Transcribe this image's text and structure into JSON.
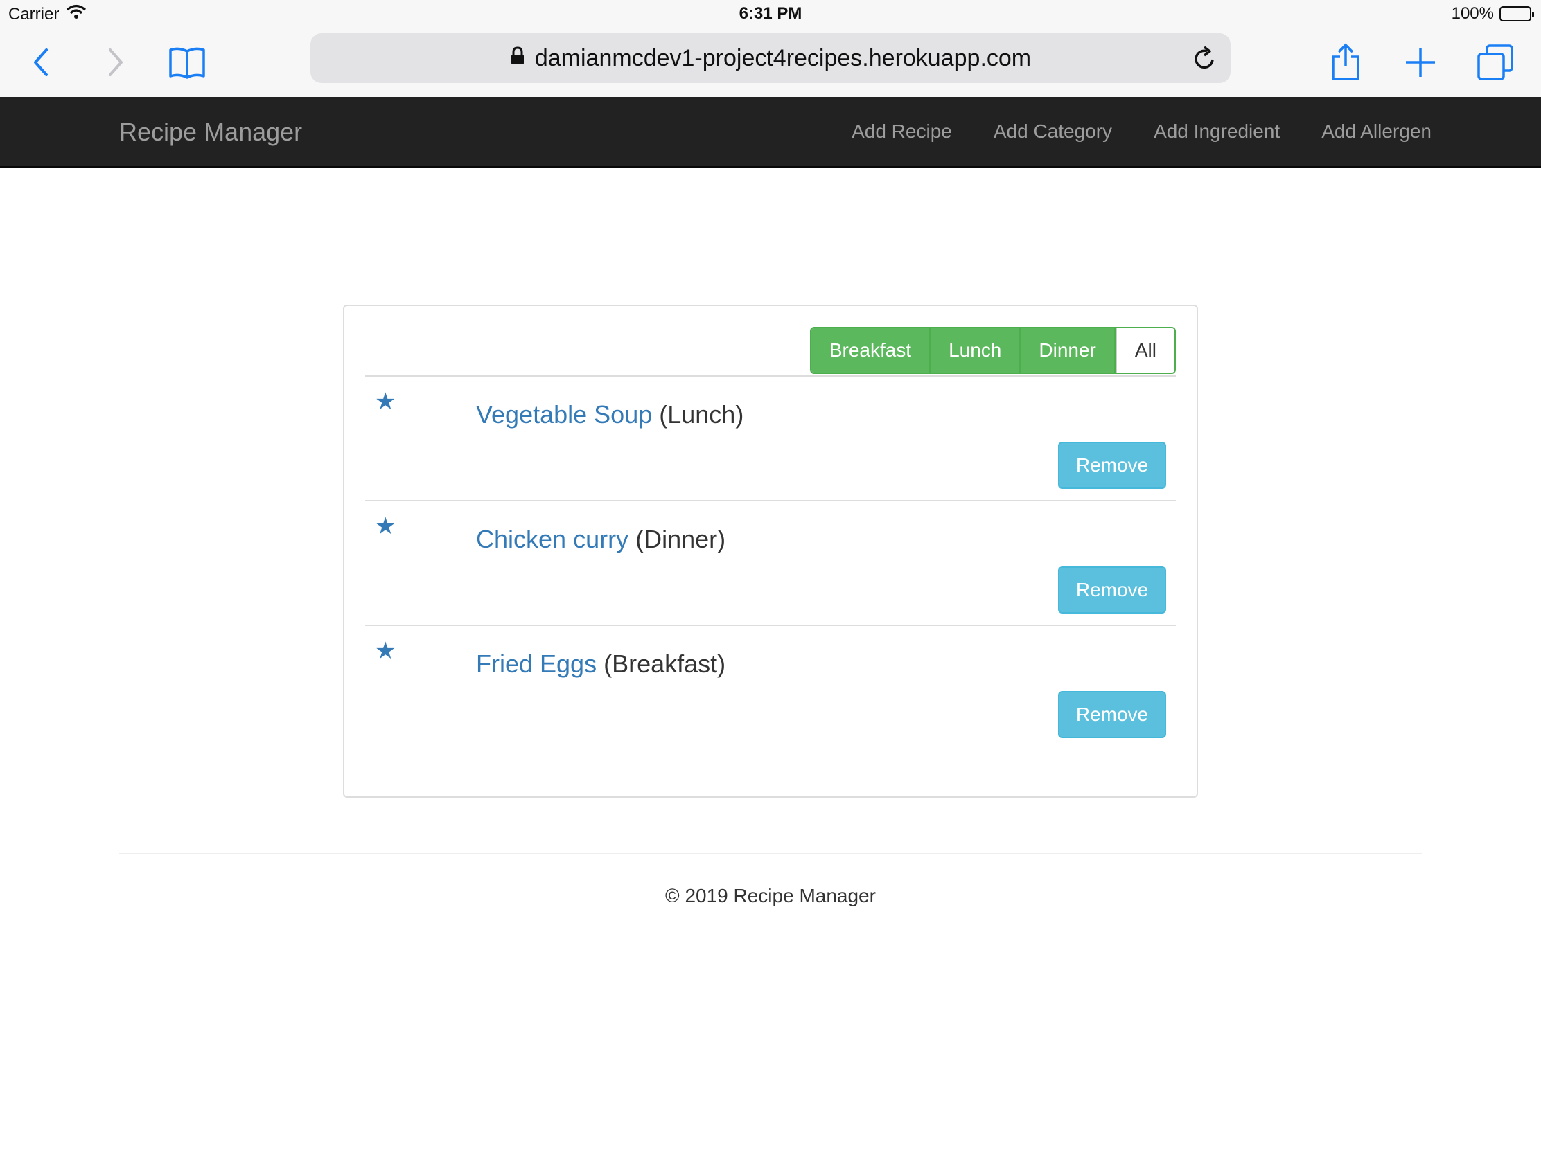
{
  "status": {
    "carrier": "Carrier",
    "time": "6:31 PM",
    "battery": "100%",
    "battery_level": 1.0
  },
  "browser": {
    "url": "damianmcdev1-project4recipes.herokuapp.com",
    "accent_color": "#1a7ef5"
  },
  "navbar": {
    "brand": "Recipe Manager",
    "links": [
      "Add Recipe",
      "Add Category",
      "Add Ingredient",
      "Add Allergen"
    ]
  },
  "filters": {
    "breakfast": "Breakfast",
    "lunch": "Lunch",
    "dinner": "Dinner",
    "all": "All"
  },
  "recipes": [
    {
      "name": "Vegetable Soup",
      "category": "(Lunch)",
      "remove_label": "Remove"
    },
    {
      "name": "Chicken curry",
      "category": "(Dinner)",
      "remove_label": "Remove"
    },
    {
      "name": "Fried Eggs",
      "category": "(Breakfast)",
      "remove_label": "Remove"
    }
  ],
  "footer": {
    "text": "© 2019 Recipe Manager"
  },
  "colors": {
    "navbar_bg": "#222222",
    "success": "#5cb85c",
    "info": "#5bc0de",
    "link": "#337ab7"
  }
}
